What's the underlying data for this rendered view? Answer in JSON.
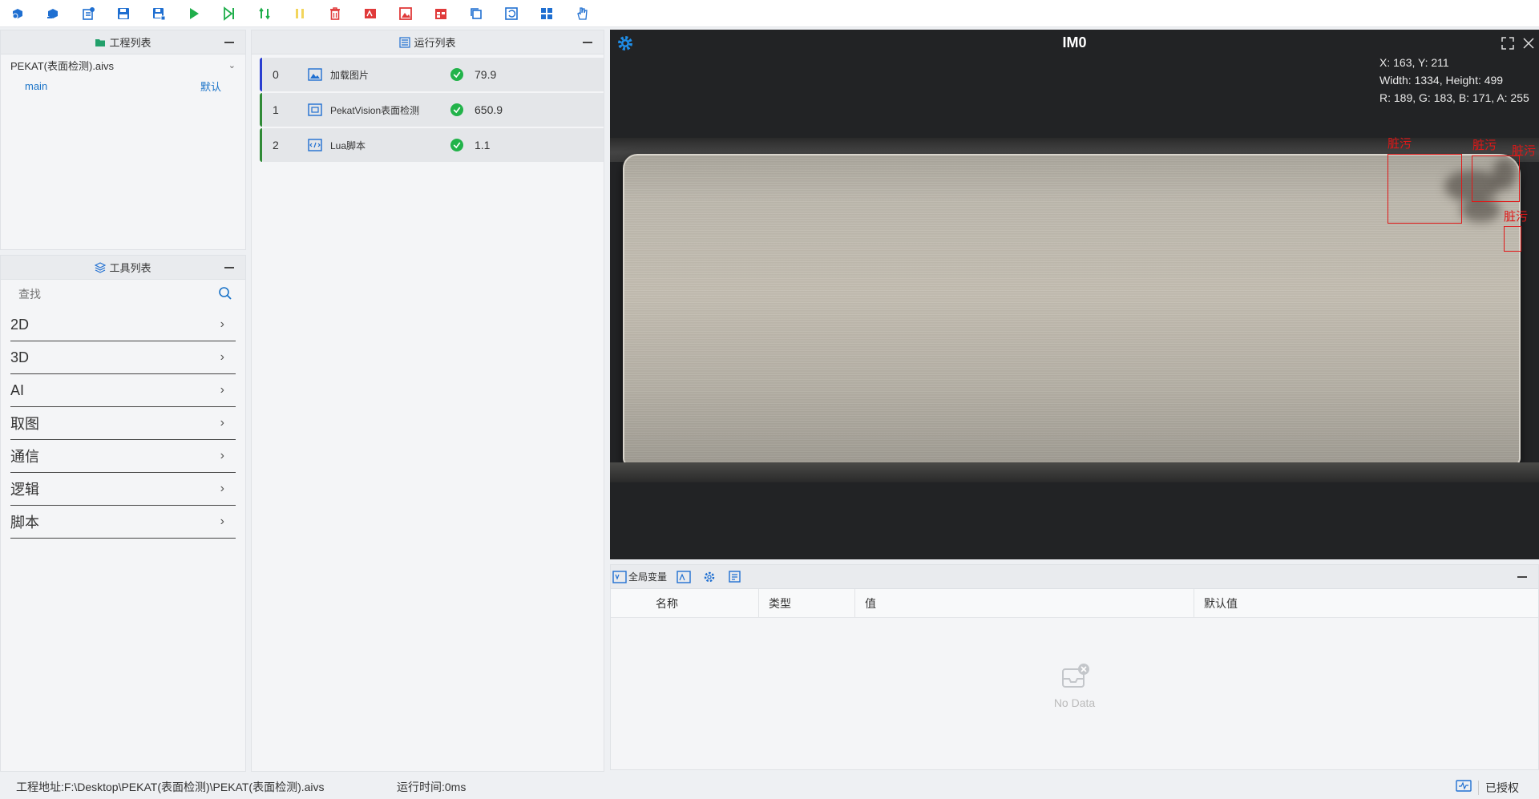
{
  "toolbar": {
    "buttons": [
      {
        "name": "new-project-icon",
        "color": "#1f6fd1"
      },
      {
        "name": "open-project-icon",
        "color": "#1f6fd1"
      },
      {
        "name": "project-settings-icon",
        "color": "#1f6fd1"
      },
      {
        "name": "save-icon",
        "color": "#1f6fd1"
      },
      {
        "name": "save-as-icon",
        "color": "#1f6fd1"
      },
      {
        "name": "run-icon",
        "color": "#1fae4b"
      },
      {
        "name": "run-once-icon",
        "color": "#1fae4b"
      },
      {
        "name": "loop-run-icon",
        "color": "#1fae4b"
      },
      {
        "name": "pause-icon",
        "color": "#f2d55c"
      },
      {
        "name": "delete-icon",
        "color": "#e03a3a"
      },
      {
        "name": "image-text-icon",
        "color": "#e03a3a"
      },
      {
        "name": "image-icon",
        "color": "#e03a3a"
      },
      {
        "name": "calendar-icon",
        "color": "#e03a3a"
      },
      {
        "name": "copy-icon",
        "color": "#1f6fd1"
      },
      {
        "name": "refresh-icon",
        "color": "#1f6fd1"
      },
      {
        "name": "layout-icon",
        "color": "#1f6fd1"
      },
      {
        "name": "hand-icon",
        "color": "#1f6fd1"
      }
    ]
  },
  "project_panel": {
    "title": "工程列表",
    "file": "PEKAT(表面检测).aivs",
    "main_label": "main",
    "main_tag": "默认"
  },
  "tool_panel": {
    "title": "工具列表",
    "search_placeholder": "查找",
    "categories": [
      "2D",
      "3D",
      "AI",
      "取图",
      "通信",
      "逻辑",
      "脚本"
    ]
  },
  "run_panel": {
    "title": "运行列表",
    "items": [
      {
        "index": "0",
        "name": "加载图片",
        "time": "79.9",
        "icon": "image-icon"
      },
      {
        "index": "1",
        "name": "PekatVision表面检测",
        "time": "650.9",
        "icon": "vision-icon"
      },
      {
        "index": "2",
        "name": "Lua脚本",
        "time": "1.1",
        "icon": "script-icon"
      }
    ]
  },
  "image_view": {
    "title": "IM0",
    "info_pos": "X: 163, Y: 211",
    "info_size": "Width: 1334, Height: 499",
    "info_rgba": "R: 189, G: 183, B: 171, A: 255",
    "defect_label": "脏污"
  },
  "variables_panel": {
    "tab_global": "全局变量",
    "columns": [
      "名称",
      "类型",
      "值",
      "默认值"
    ],
    "empty_text": "No Data"
  },
  "status_bar": {
    "path": "工程地址:F:\\Desktop\\PEKAT(表面检测)\\PEKAT(表面检测).aivs",
    "run_time": "运行时间:0ms",
    "license": "已授权"
  }
}
